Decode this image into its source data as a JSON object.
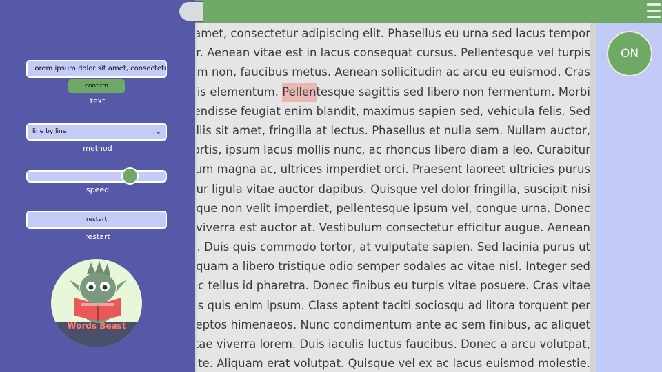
{
  "sidebar": {
    "text_input_value": "Lorem ipsum dolor sit amet, consectetur a",
    "confirm_label": "confirm",
    "text_label": "text",
    "method_value": "line by line",
    "method_label": "method",
    "speed_label": "speed",
    "speed_fraction": 0.74,
    "restart_button": "restart",
    "restart_label": "restart",
    "logo_text": "Words Beast"
  },
  "toggle": {
    "label": "ON"
  },
  "reader": {
    "lines": [
      [
        "amet, consectetur adipiscing elit. Phasellus eu urna sed lacus tempor",
        "",
        ""
      ],
      [
        "or. Aenean vitae est in lacus consequat cursus. Pellentesque vel turpis",
        "",
        ""
      ],
      [
        "diam non, faucibus metus. Aenean sollicitudin ac arcu eu euismod. Cras",
        "",
        ""
      ],
      [
        "hollis elementum. ",
        "Pellen",
        "tesque sagittis sed libero non fermentum. Morbi"
      ],
      [
        "pendisse feugiat enim blandit, maximus sapien sed, vehicula felis. Sed",
        "",
        ""
      ],
      [
        "c mollis sit amet, fringilla at lectus. Phasellus et nulla sem. Nullam auctor,",
        "",
        ""
      ],
      [
        "obortis, ipsum lacus mollis nunc, ac rhoncus libero diam a leo. Curabitur",
        "",
        ""
      ],
      [
        "um magna ac, ultrices imperdiet orci. Praesent laoreet ultricies purus",
        "",
        ""
      ],
      [
        "efficitur ligula vitae auctor dapibus. Quisque vel dolor fringilla, suscipit nisi",
        "",
        ""
      ],
      [
        "ique non velit imperdiet, pellentesque ipsum vel, congue urna. Donec",
        "",
        ""
      ],
      [
        "d viverra est auctor at. Vestibulum consectetur efficitur augue. Aenean",
        "",
        ""
      ],
      [
        "arius. Duis quis commodo tortor, at vulputate sapien. Sed lacinia purus ut",
        "",
        ""
      ],
      [
        "liquam a libero tristique odio semper sodales ac vitae nisl. Integer sed",
        "",
        ""
      ],
      [
        "nec tellus id pharetra. Donec finibus eu turpis vitae posuere. Cras vitae",
        "",
        ""
      ],
      [
        "llus quis enim ipsum. Class aptent taciti sociosqu ad litora torquent per",
        "",
        ""
      ],
      [
        "nceptos himenaeos. Nunc condimentum ante ac sem finibus, ac aliquet",
        "",
        ""
      ],
      [
        "m vitae viverra lorem. Duis iaculis luctus faucibus. Donec a arcu volutpat,",
        "",
        ""
      ],
      [
        "la ante. Aliquam erat volutpat. Quisque vel ex ac lacus euismod molestie.",
        "",
        ""
      ]
    ]
  },
  "colors": {
    "sidebar": "#5559a8",
    "accent_green": "#6fa966",
    "panel_light": "#c1c9f7",
    "highlight": "#eab8b4"
  }
}
